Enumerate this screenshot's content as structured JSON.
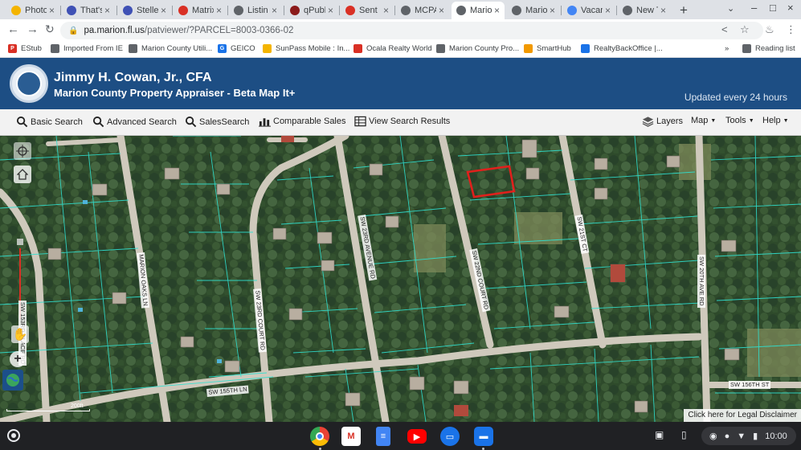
{
  "browser": {
    "tabs": [
      {
        "label": "Photo",
        "color": "#f4b400",
        "active": false
      },
      {
        "label": "That's",
        "color": "#3f51b5",
        "active": false
      },
      {
        "label": "Stelle",
        "color": "#3f51b5",
        "active": false
      },
      {
        "label": "Matrix",
        "color": "#d93025",
        "active": false
      },
      {
        "label": "Listin",
        "color": "#5f6368",
        "active": false
      },
      {
        "label": "qPubl",
        "color": "#8b1a1a",
        "active": false
      },
      {
        "label": "Sent",
        "color": "#d93025",
        "active": false
      },
      {
        "label": "MCPA",
        "color": "#5f6368",
        "active": false
      },
      {
        "label": "Mario",
        "color": "#5f6368",
        "active": true
      },
      {
        "label": "Mario",
        "color": "#5f6368",
        "active": false
      },
      {
        "label": "Vacan",
        "color": "#4285f4",
        "active": false
      },
      {
        "label": "New T",
        "color": "#5f6368",
        "active": false
      }
    ],
    "url_host": "pa.marion.fl.us",
    "url_path": "/patviewer/?PARCEL=8003-0366-02",
    "bookmarks": [
      {
        "label": "EStub",
        "color": "#d93025",
        "glyph": "P"
      },
      {
        "label": "Imported From IE",
        "color": "#5f6368",
        "glyph": ""
      },
      {
        "label": "Marion County Utili...",
        "color": "#5f6368",
        "glyph": ""
      },
      {
        "label": "GEICO",
        "color": "#1a73e8",
        "glyph": "G"
      },
      {
        "label": "SunPass Mobile : In...",
        "color": "#f4b400",
        "glyph": ""
      },
      {
        "label": "Ocala Realty World",
        "color": "#d93025",
        "glyph": ""
      },
      {
        "label": "Marion County Pro...",
        "color": "#5f6368",
        "glyph": ""
      },
      {
        "label": "SmartHub",
        "color": "#f29900",
        "glyph": ""
      },
      {
        "label": "RealtyBackOffice |...",
        "color": "#1a73e8",
        "glyph": ""
      }
    ],
    "more_bookmarks": "»",
    "reading_list": "Reading list"
  },
  "site": {
    "title_line1": "Jimmy H. Cowan, Jr., CFA",
    "title_line2": "Marion County Property Appraiser - Beta Map It+",
    "updated": "Updated every 24 hours",
    "header_color": "#1d4e84"
  },
  "toolbar": {
    "basic_search": "Basic Search",
    "advanced_search": "Advanced Search",
    "sales_search": "SalesSearch",
    "comparable_sales": "Comparable Sales",
    "view_search_results": "View Search Results",
    "layers": "Layers",
    "map": "Map",
    "tools": "Tools",
    "help": "Help"
  },
  "map": {
    "streets": [
      {
        "name": "SW 153RD PLACE RD"
      },
      {
        "name": "MARION OAKS LN"
      },
      {
        "name": "SW 23RD COURT RD"
      },
      {
        "name": "SW 23RD AVENUE RD"
      },
      {
        "name": "SW 22ND COURT RD"
      },
      {
        "name": "SW 21ST CT"
      },
      {
        "name": "SW 20TH AVE RD"
      },
      {
        "name": "SW 155TH LN"
      },
      {
        "name": "SW 156TH ST"
      }
    ],
    "scale_label": "200ft",
    "disclaimer": "Click here for Legal Disclaimer",
    "selected_parcel_color": "#e0201c",
    "parcel_line_color": "#2fe0d0"
  },
  "shelf": {
    "apps": [
      {
        "name": "chrome",
        "color": "#4285f4"
      },
      {
        "name": "gmail",
        "color": "#ffffff"
      },
      {
        "name": "docs",
        "color": "#4285f4"
      },
      {
        "name": "youtube",
        "color": "#ff0000"
      },
      {
        "name": "messages",
        "color": "#1a73e8"
      },
      {
        "name": "files",
        "color": "#1a73e8"
      }
    ],
    "time": "10:00"
  }
}
